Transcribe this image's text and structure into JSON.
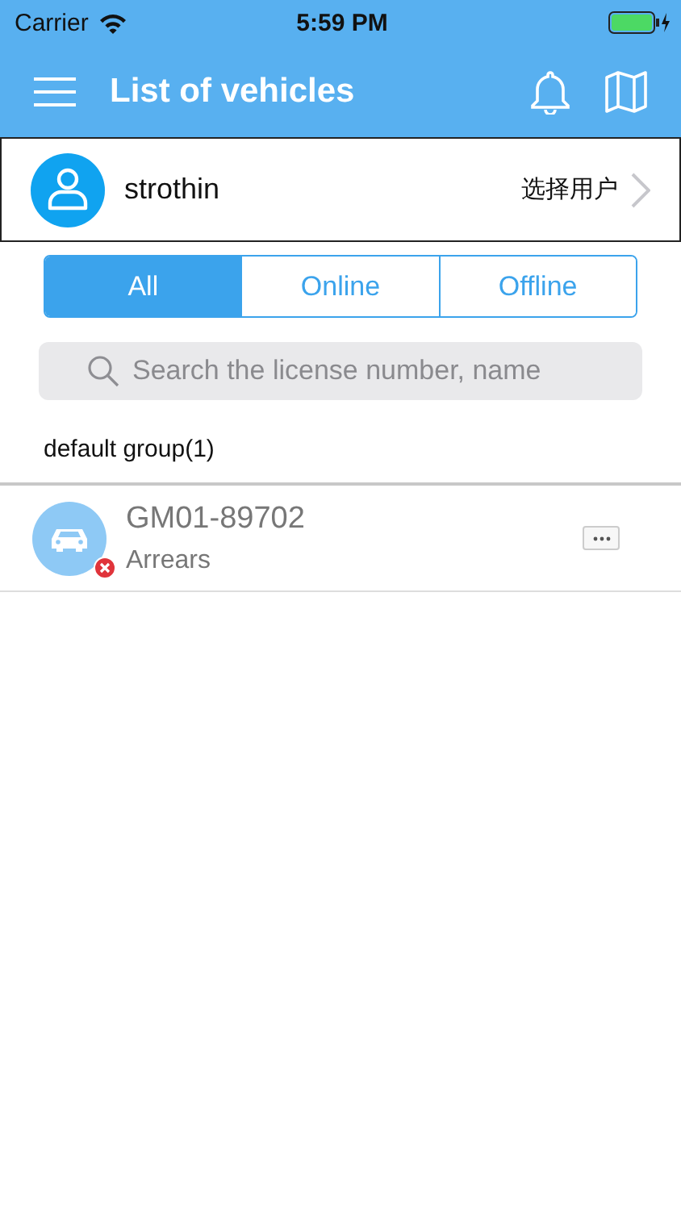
{
  "status_bar": {
    "carrier": "Carrier",
    "time": "5:59 PM"
  },
  "nav_bar": {
    "title": "List of vehicles"
  },
  "user": {
    "name": "strothin",
    "action": "选择用户"
  },
  "tabs": [
    {
      "label": "All",
      "selected": true
    },
    {
      "label": "Online",
      "selected": false
    },
    {
      "label": "Offline",
      "selected": false
    }
  ],
  "search": {
    "placeholder": "Search the license number, name"
  },
  "group": {
    "label": "default group(1)"
  },
  "vehicles": [
    {
      "plate": "GM01-89702",
      "status": "Arrears",
      "offline": true
    }
  ]
}
